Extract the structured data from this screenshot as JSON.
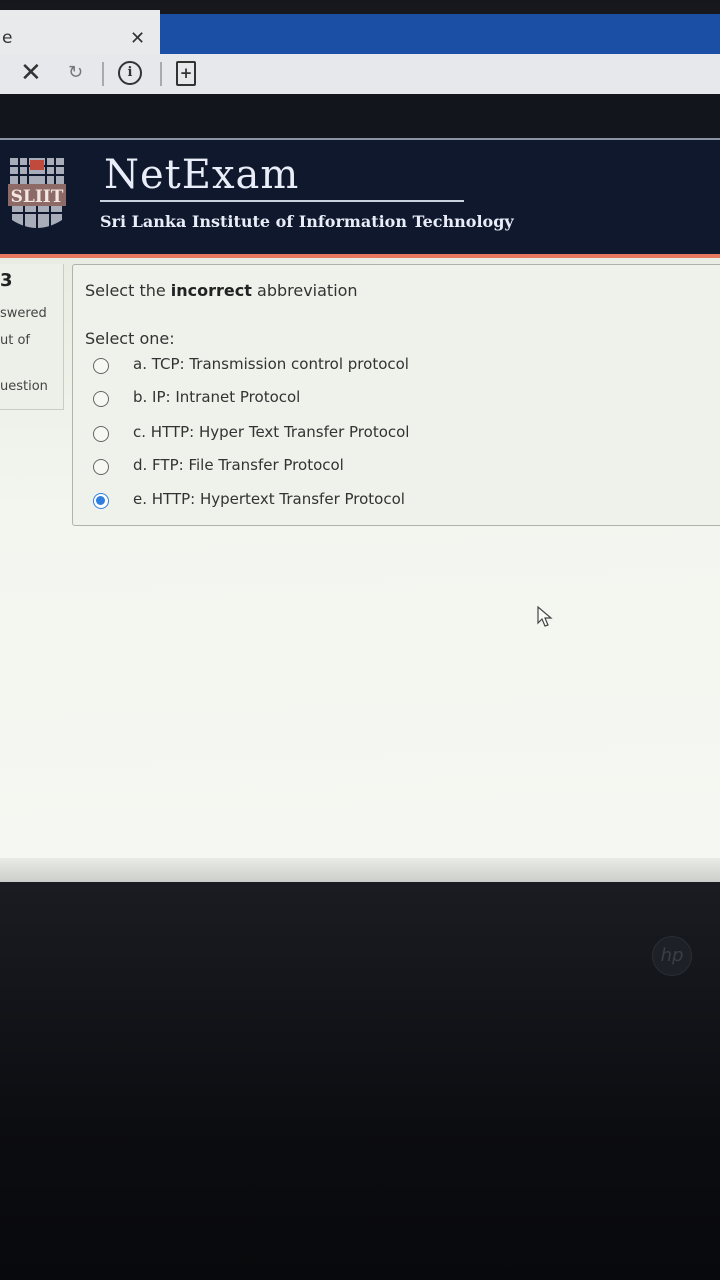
{
  "browser": {
    "tab_title": "e",
    "tab_close_glyph": "✕",
    "stop_glyph": "✕",
    "refresh_glyph": "↻",
    "info_glyph": "i",
    "page_glyph": "+"
  },
  "header": {
    "brand": "NetExam",
    "subtitle": "Sri Lanka Institute of Information Technology",
    "logo_text": "SLIIT",
    "colors": {
      "background": "#10182e",
      "accent": "#e7775e"
    }
  },
  "info_panel": {
    "question_number": "3",
    "status": "swered",
    "mark": "ut of",
    "flag": "uestion"
  },
  "question": {
    "prefix": "Select the ",
    "emphasis": "incorrect",
    "suffix": " abbreviation",
    "select_label": "Select one:",
    "options": [
      {
        "label": "a. TCP: Transmission control protocol",
        "selected": false
      },
      {
        "label": "b. IP: Intranet Protocol",
        "selected": false
      },
      {
        "label": "c. HTTP: Hyper Text Transfer Protocol",
        "selected": false
      },
      {
        "label": "d. FTP: File Transfer Protocol",
        "selected": false
      },
      {
        "label": "e. HTTP: Hypertext Transfer Protocol",
        "selected": true
      }
    ],
    "selected_color": "#2f7fe0"
  },
  "laptop": {
    "logo_text": "hp"
  }
}
